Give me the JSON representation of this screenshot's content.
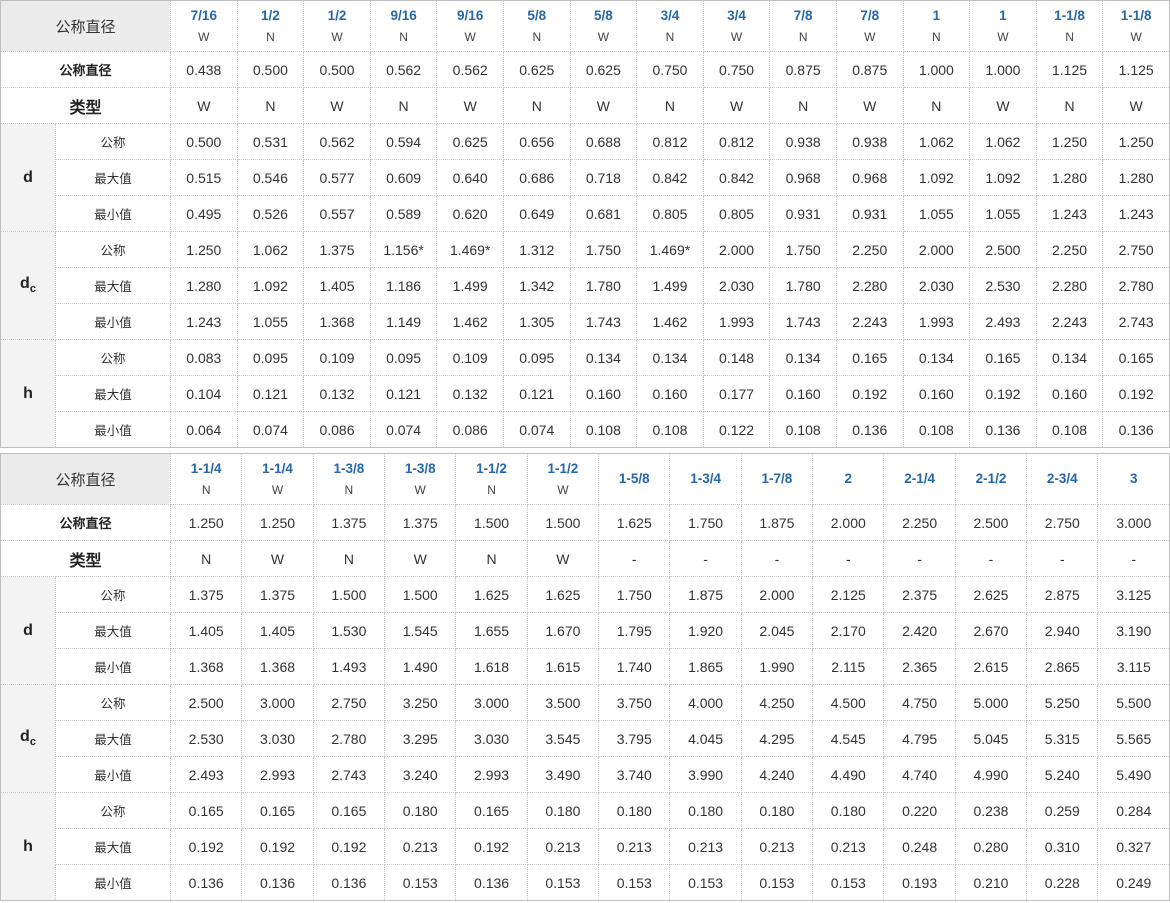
{
  "labels": {
    "nominal_diameter": "公称直径",
    "type": "类型",
    "d": "d",
    "dc": "d",
    "dc_sub": "c",
    "h": "h",
    "nominal": "公称",
    "max": "最大值",
    "min": "最小值"
  },
  "tables": [
    {
      "sizes": [
        "7/16",
        "1/2",
        "1/2",
        "9/16",
        "9/16",
        "5/8",
        "5/8",
        "3/4",
        "3/4",
        "7/8",
        "7/8",
        "1",
        "1",
        "1-1/8",
        "1-1/8"
      ],
      "header_types": [
        "W",
        "N",
        "W",
        "N",
        "W",
        "N",
        "W",
        "N",
        "W",
        "N",
        "W",
        "N",
        "W",
        "N",
        "W"
      ],
      "nominal_diameter": [
        "0.438",
        "0.500",
        "0.500",
        "0.562",
        "0.562",
        "0.625",
        "0.625",
        "0.750",
        "0.750",
        "0.875",
        "0.875",
        "1.000",
        "1.000",
        "1.125",
        "1.125"
      ],
      "type": [
        "W",
        "N",
        "W",
        "N",
        "W",
        "N",
        "W",
        "N",
        "W",
        "N",
        "W",
        "N",
        "W",
        "N",
        "W"
      ],
      "d_nominal": [
        "0.500",
        "0.531",
        "0.562",
        "0.594",
        "0.625",
        "0.656",
        "0.688",
        "0.812",
        "0.812",
        "0.938",
        "0.938",
        "1.062",
        "1.062",
        "1.250",
        "1.250"
      ],
      "d_max": [
        "0.515",
        "0.546",
        "0.577",
        "0.609",
        "0.640",
        "0.686",
        "0.718",
        "0.842",
        "0.842",
        "0.968",
        "0.968",
        "1.092",
        "1.092",
        "1.280",
        "1.280"
      ],
      "d_min": [
        "0.495",
        "0.526",
        "0.557",
        "0.589",
        "0.620",
        "0.649",
        "0.681",
        "0.805",
        "0.805",
        "0.931",
        "0.931",
        "1.055",
        "1.055",
        "1.243",
        "1.243"
      ],
      "dc_nominal": [
        "1.250",
        "1.062",
        "1.375",
        "1.156*",
        "1.469*",
        "1.312",
        "1.750",
        "1.469*",
        "2.000",
        "1.750",
        "2.250",
        "2.000",
        "2.500",
        "2.250",
        "2.750"
      ],
      "dc_max": [
        "1.280",
        "1.092",
        "1.405",
        "1.186",
        "1.499",
        "1.342",
        "1.780",
        "1.499",
        "2.030",
        "1.780",
        "2.280",
        "2.030",
        "2.530",
        "2.280",
        "2.780"
      ],
      "dc_min": [
        "1.243",
        "1.055",
        "1.368",
        "1.149",
        "1.462",
        "1.305",
        "1.743",
        "1.462",
        "1.993",
        "1.743",
        "2.243",
        "1.993",
        "2.493",
        "2.243",
        "2.743"
      ],
      "h_nominal": [
        "0.083",
        "0.095",
        "0.109",
        "0.095",
        "0.109",
        "0.095",
        "0.134",
        "0.134",
        "0.148",
        "0.134",
        "0.165",
        "0.134",
        "0.165",
        "0.134",
        "0.165"
      ],
      "h_max": [
        "0.104",
        "0.121",
        "0.132",
        "0.121",
        "0.132",
        "0.121",
        "0.160",
        "0.160",
        "0.177",
        "0.160",
        "0.192",
        "0.160",
        "0.192",
        "0.160",
        "0.192"
      ],
      "h_min": [
        "0.064",
        "0.074",
        "0.086",
        "0.074",
        "0.086",
        "0.074",
        "0.108",
        "0.108",
        "0.122",
        "0.108",
        "0.136",
        "0.108",
        "0.136",
        "0.108",
        "0.136"
      ]
    },
    {
      "sizes": [
        "1-1/4",
        "1-1/4",
        "1-3/8",
        "1-3/8",
        "1-1/2",
        "1-1/2",
        "1-5/8",
        "1-3/4",
        "1-7/8",
        "2",
        "2-1/4",
        "2-1/2",
        "2-3/4",
        "3"
      ],
      "header_types": [
        "N",
        "W",
        "N",
        "W",
        "N",
        "W",
        "",
        "",
        "",
        "",
        "",
        "",
        "",
        ""
      ],
      "nominal_diameter": [
        "1.250",
        "1.250",
        "1.375",
        "1.375",
        "1.500",
        "1.500",
        "1.625",
        "1.750",
        "1.875",
        "2.000",
        "2.250",
        "2.500",
        "2.750",
        "3.000"
      ],
      "type": [
        "N",
        "W",
        "N",
        "W",
        "N",
        "W",
        "-",
        "-",
        "-",
        "-",
        "-",
        "-",
        "-",
        "-"
      ],
      "d_nominal": [
        "1.375",
        "1.375",
        "1.500",
        "1.500",
        "1.625",
        "1.625",
        "1.750",
        "1.875",
        "2.000",
        "2.125",
        "2.375",
        "2.625",
        "2.875",
        "3.125"
      ],
      "d_max": [
        "1.405",
        "1.405",
        "1.530",
        "1.545",
        "1.655",
        "1.670",
        "1.795",
        "1.920",
        "2.045",
        "2.170",
        "2.420",
        "2.670",
        "2.940",
        "3.190"
      ],
      "d_min": [
        "1.368",
        "1.368",
        "1.493",
        "1.490",
        "1.618",
        "1.615",
        "1.740",
        "1.865",
        "1.990",
        "2.115",
        "2.365",
        "2.615",
        "2.865",
        "3.115"
      ],
      "dc_nominal": [
        "2.500",
        "3.000",
        "2.750",
        "3.250",
        "3.000",
        "3.500",
        "3.750",
        "4.000",
        "4.250",
        "4.500",
        "4.750",
        "5.000",
        "5.250",
        "5.500"
      ],
      "dc_max": [
        "2.530",
        "3.030",
        "2.780",
        "3.295",
        "3.030",
        "3.545",
        "3.795",
        "4.045",
        "4.295",
        "4.545",
        "4.795",
        "5.045",
        "5.315",
        "5.565"
      ],
      "dc_min": [
        "2.493",
        "2.993",
        "2.743",
        "3.240",
        "2.993",
        "3.490",
        "3.740",
        "3.990",
        "4.240",
        "4.490",
        "4.740",
        "4.990",
        "5.240",
        "5.490"
      ],
      "h_nominal": [
        "0.165",
        "0.165",
        "0.165",
        "0.180",
        "0.165",
        "0.180",
        "0.180",
        "0.180",
        "0.180",
        "0.180",
        "0.220",
        "0.238",
        "0.259",
        "0.284"
      ],
      "h_max": [
        "0.192",
        "0.192",
        "0.192",
        "0.213",
        "0.192",
        "0.213",
        "0.213",
        "0.213",
        "0.213",
        "0.213",
        "0.248",
        "0.280",
        "0.310",
        "0.327"
      ],
      "h_min": [
        "0.136",
        "0.136",
        "0.136",
        "0.153",
        "0.136",
        "0.153",
        "0.153",
        "0.153",
        "0.153",
        "0.153",
        "0.193",
        "0.210",
        "0.228",
        "0.249"
      ]
    }
  ]
}
